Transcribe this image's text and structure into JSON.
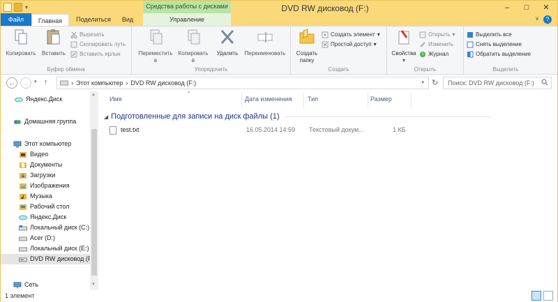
{
  "window": {
    "title": "DVD RW дисковод (F:)",
    "context_group": "Средства работы с дисками",
    "minimize": "–",
    "maximize": "□",
    "close": "✕"
  },
  "tabs": {
    "file": "Файл",
    "home": "Главная",
    "share": "Поделиться",
    "view": "Вид",
    "manage": "Управление",
    "help": "?"
  },
  "ribbon": {
    "clipboard": {
      "label": "Буфер обмена",
      "copy": "Копировать",
      "paste": "Вставить",
      "cut": "Вырезать",
      "copy_path": "Скопировать путь",
      "paste_shortcut": "Вставить ярлык"
    },
    "organize": {
      "label": "Упорядочить",
      "move_to_1": "Переместить",
      "move_to_2": "в",
      "copy_to_1": "Копировать",
      "copy_to_2": "в",
      "delete": "Удалить",
      "rename": "Переименовать"
    },
    "create": {
      "label": "Создать",
      "new_folder_1": "Создать",
      "new_folder_2": "папку",
      "new_item": "Создать элемент",
      "easy_access": "Простой доступ"
    },
    "open": {
      "label": "Открыть",
      "properties": "Свойства",
      "open": "Открыть",
      "edit": "Изменить",
      "history": "Журнал"
    },
    "select": {
      "label": "Выделить",
      "select_all": "Выделить все",
      "select_none": "Снять выделение",
      "invert": "Обратить выделение"
    }
  },
  "nav": {
    "breadcrumb": [
      "Этот компьютер",
      "DVD RW дисковод (F:)"
    ],
    "search_placeholder": "Поиск: DVD RW дисковод (F:)"
  },
  "sidebar": {
    "items": [
      {
        "label": "Яндекс.Диск",
        "icon": "yandex-disk-icon"
      },
      {
        "label": "Домашняя группа",
        "icon": "homegroup-icon"
      },
      {
        "label": "Этот компьютер",
        "icon": "computer-icon"
      },
      {
        "label": "Видео",
        "icon": "video-folder-icon"
      },
      {
        "label": "Документы",
        "icon": "documents-folder-icon"
      },
      {
        "label": "Загрузки",
        "icon": "downloads-folder-icon"
      },
      {
        "label": "Изображения",
        "icon": "pictures-folder-icon"
      },
      {
        "label": "Музыка",
        "icon": "music-folder-icon"
      },
      {
        "label": "Рабочий стол",
        "icon": "desktop-folder-icon"
      },
      {
        "label": "Яндекс.Диск",
        "icon": "yandex-disk-icon"
      },
      {
        "label": "Локальный диск (C:)",
        "icon": "drive-icon"
      },
      {
        "label": "Acer (D:)",
        "icon": "drive-icon"
      },
      {
        "label": "Локальный диск (E:)",
        "icon": "drive-icon"
      },
      {
        "label": "DVD RW дисковод (F:)",
        "icon": "dvd-drive-icon"
      },
      {
        "label": "Сеть",
        "icon": "network-icon"
      }
    ]
  },
  "columns": {
    "name": "Имя",
    "date": "Дата изменения",
    "type": "Тип",
    "size": "Размер"
  },
  "file_group": {
    "title": "Подготовленные для записи на диск файлы (1)"
  },
  "files": [
    {
      "name": "test.txt",
      "date": "16.05.2014 14:59",
      "type": "Текстовый докум...",
      "size": "1 КБ"
    }
  ],
  "status": {
    "count": "1 элемент"
  },
  "colors": {
    "titlebar": "#fbd979",
    "file_tab": "#1979ca",
    "context_tab": "#b9e3a7",
    "group_header": "#1e3287"
  }
}
